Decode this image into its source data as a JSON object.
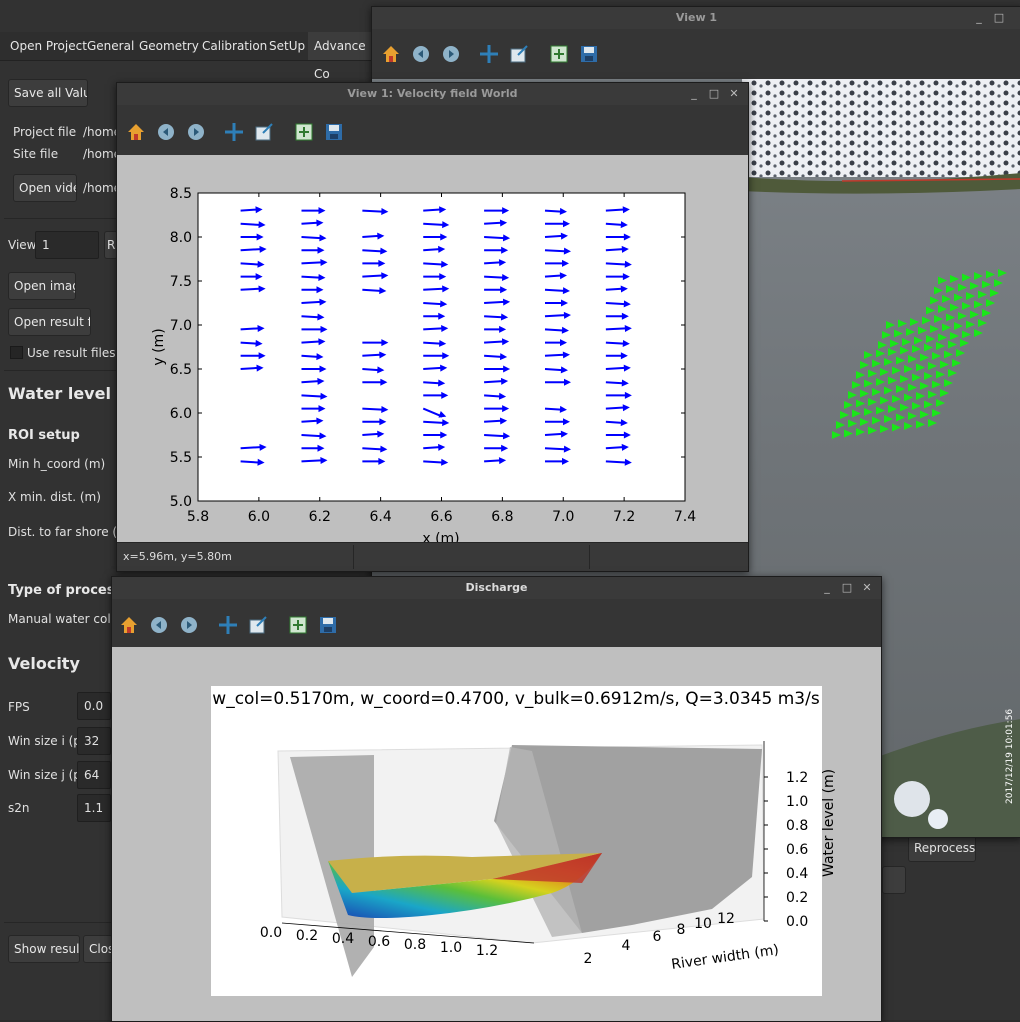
{
  "main": {
    "tabs": [
      "Open Project",
      "General",
      "Geometry",
      "Calibration",
      "SetUp",
      "Advance Co"
    ],
    "save_all": "Save all Values",
    "project_file_label": "Project file",
    "project_file_value": "/home",
    "site_file_label": "Site file",
    "site_file_value": "/home",
    "open_video": "Open video",
    "video_value": "/home",
    "view_label": "View",
    "view_value": "1",
    "view_btn_partial": "R",
    "open_image": "Open image",
    "open_result": "Open result file",
    "use_result": "Use result files",
    "water_level": "Water level",
    "roi_setup": "ROI setup",
    "min_h": "Min h_coord (m)",
    "x_min": "X min. dist. (m)",
    "dist_far": "Dist. to far shore (m)",
    "type_proc": "Type of processin",
    "manual_water": "Manual water column",
    "velocity": "Velocity",
    "fps_label": "FPS",
    "fps_value": "0.0",
    "win_i_label": "Win size i (px)",
    "win_i_value": "32",
    "win_j_label": "Win size j (px)",
    "win_j_value": "64",
    "s2n_label": "s2n",
    "s2n_value": "1.1",
    "show_results": "Show results",
    "close": "Close",
    "reprocess": "Reprocess"
  },
  "view1": {
    "title": "View 1",
    "timestamp": "2017/12/19 10:01:56"
  },
  "velocity_win": {
    "title": "View 1: Velocity field World",
    "status": "x=5.96m, y=5.80m"
  },
  "discharge_win": {
    "title": "Discharge"
  },
  "chart_data": [
    {
      "type": "quiver",
      "xlabel": "x (m)",
      "ylabel": "y (m)",
      "xlim": [
        5.8,
        7.4
      ],
      "ylim": [
        5.0,
        8.5
      ],
      "xticks": [
        "5.8",
        "6.0",
        "6.2",
        "6.4",
        "6.6",
        "6.8",
        "7.0",
        "7.2",
        "7.4"
      ],
      "yticks": [
        "5.0",
        "5.5",
        "6.0",
        "6.5",
        "7.0",
        "7.5",
        "8.0",
        "8.5"
      ],
      "color": "#0000ff",
      "columns_x": [
        5.94,
        6.14,
        6.34,
        6.54,
        6.74,
        6.94,
        7.14
      ],
      "rows_y": [
        8.3,
        8.15,
        8.0,
        7.85,
        7.7,
        7.55,
        7.4,
        7.25,
        7.1,
        6.95,
        6.8,
        6.65,
        6.5,
        6.35,
        6.2,
        6.05,
        5.9,
        5.75,
        5.6,
        5.45
      ],
      "grid": false
    },
    {
      "type": "surface3d",
      "title": "w_col=0.5170m, w_coord=0.4700, v_bulk=0.6912m/s, Q=3.0345 m3/s",
      "xticks": [
        "0.0",
        "0.2",
        "0.4",
        "0.6",
        "0.8",
        "1.0",
        "1.2"
      ],
      "yticks": [
        "2",
        "4",
        "6",
        "8",
        "10",
        "12"
      ],
      "zticks": [
        "0.0",
        "0.2",
        "0.4",
        "0.6",
        "0.8",
        "1.0",
        "1.2"
      ],
      "ylabel": "River width (m)",
      "zlabel": "Water level (m)"
    }
  ]
}
